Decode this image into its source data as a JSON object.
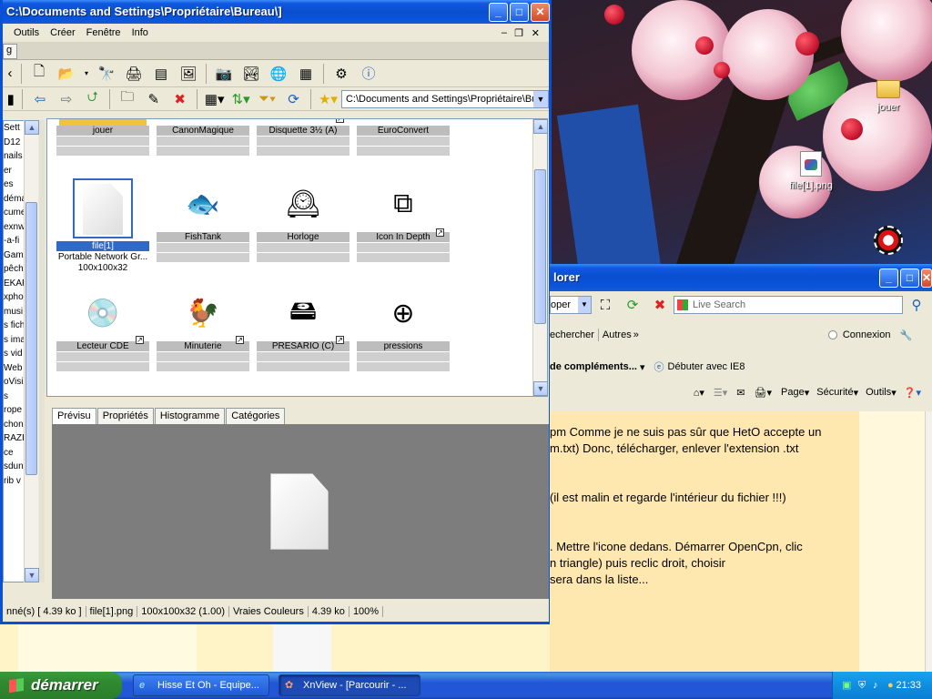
{
  "desktop": {
    "icons": [
      {
        "label": "jouer"
      },
      {
        "label": "file[1].png"
      }
    ]
  },
  "xnview": {
    "title": "C:\\Documents and Settings\\Propriétaire\\Bureau\\]",
    "tab_fragment": "g",
    "menu": [
      "Outils",
      "Créer",
      "Fenêtre",
      "Info"
    ],
    "address": "C:\\Documents and Settings\\Propriétaire\\Bur",
    "left_tree": [
      "Sett",
      "D12",
      "nails",
      "er",
      "es",
      "démar",
      "cume",
      "exnw",
      "-a-fi",
      "Game",
      "pêch",
      "EKAP",
      "xpho",
      "musi",
      "s fich",
      "s ima",
      "s vid",
      "Web",
      "oVisi",
      "s",
      "rope",
      "chon",
      "RAZI",
      "ce",
      "sdun",
      "rib v"
    ],
    "rows": [
      {
        "items": [
          {
            "label": "jouer",
            "icon": "folder-icon"
          },
          {
            "label": "CanonMagique",
            "icon": "blank"
          },
          {
            "label": "Disquette 3½ (A)",
            "icon": "blank"
          },
          {
            "label": "EuroConvert",
            "icon": "blank"
          }
        ]
      },
      {
        "items": [
          {
            "label": "file[1]",
            "icon": "file-icon",
            "selected": true,
            "info1": "Portable Network Gr...",
            "info2": "100x100x32"
          },
          {
            "label": "FishTank",
            "icon": "fish-icon"
          },
          {
            "label": "Horloge",
            "icon": "clock-icon"
          },
          {
            "label": "Icon In Depth",
            "icon": "app-icon"
          }
        ]
      },
      {
        "items": [
          {
            "label": "Lecteur CDE",
            "icon": "dvd-icon"
          },
          {
            "label": "Minuterie",
            "icon": "rooster-icon"
          },
          {
            "label": "PRESARIO (C)",
            "icon": "drive-icon"
          },
          {
            "label": "pressions",
            "icon": "gauge-icon"
          }
        ]
      }
    ],
    "tabs": [
      "Prévisu",
      "Propriétés",
      "Histogramme",
      "Catégories"
    ],
    "status": [
      "nné(s)  [ 4.39 ko ]",
      "file[1].png",
      "100x100x32 (1.00)",
      "Vraies Couleurs",
      "4.39 ko",
      "100%"
    ]
  },
  "ie": {
    "title_fragment": "lorer",
    "dropdown_fragment": "oper",
    "search_placeholder": "Live Search",
    "links_fragment": "echercher",
    "links_autres": "Autres",
    "connexion": "Connexion",
    "fav_fragment": "de compléments...",
    "ie8_link": "Débuter avec IE8",
    "cmd": [
      "Page",
      "Sécurité",
      "Outils"
    ],
    "content": [
      "pm Comme je ne suis pas sûr que HetO accepte un",
      "m.txt) Donc, télécharger, enlever l'extension .txt",
      "(il est malin et regarde l'intérieur du fichier !!!)",
      ". Mettre l'icone dedans. Démarrer OpenCpn, clic",
      "n triangle) puis reclic droit, choisir",
      "sera dans la liste..."
    ]
  },
  "taskbar": {
    "start": "démarrer",
    "tasks": [
      "Hisse Et Oh - Equipe...",
      "XnView - [Parcourir - ..."
    ],
    "clock": "21:33"
  }
}
